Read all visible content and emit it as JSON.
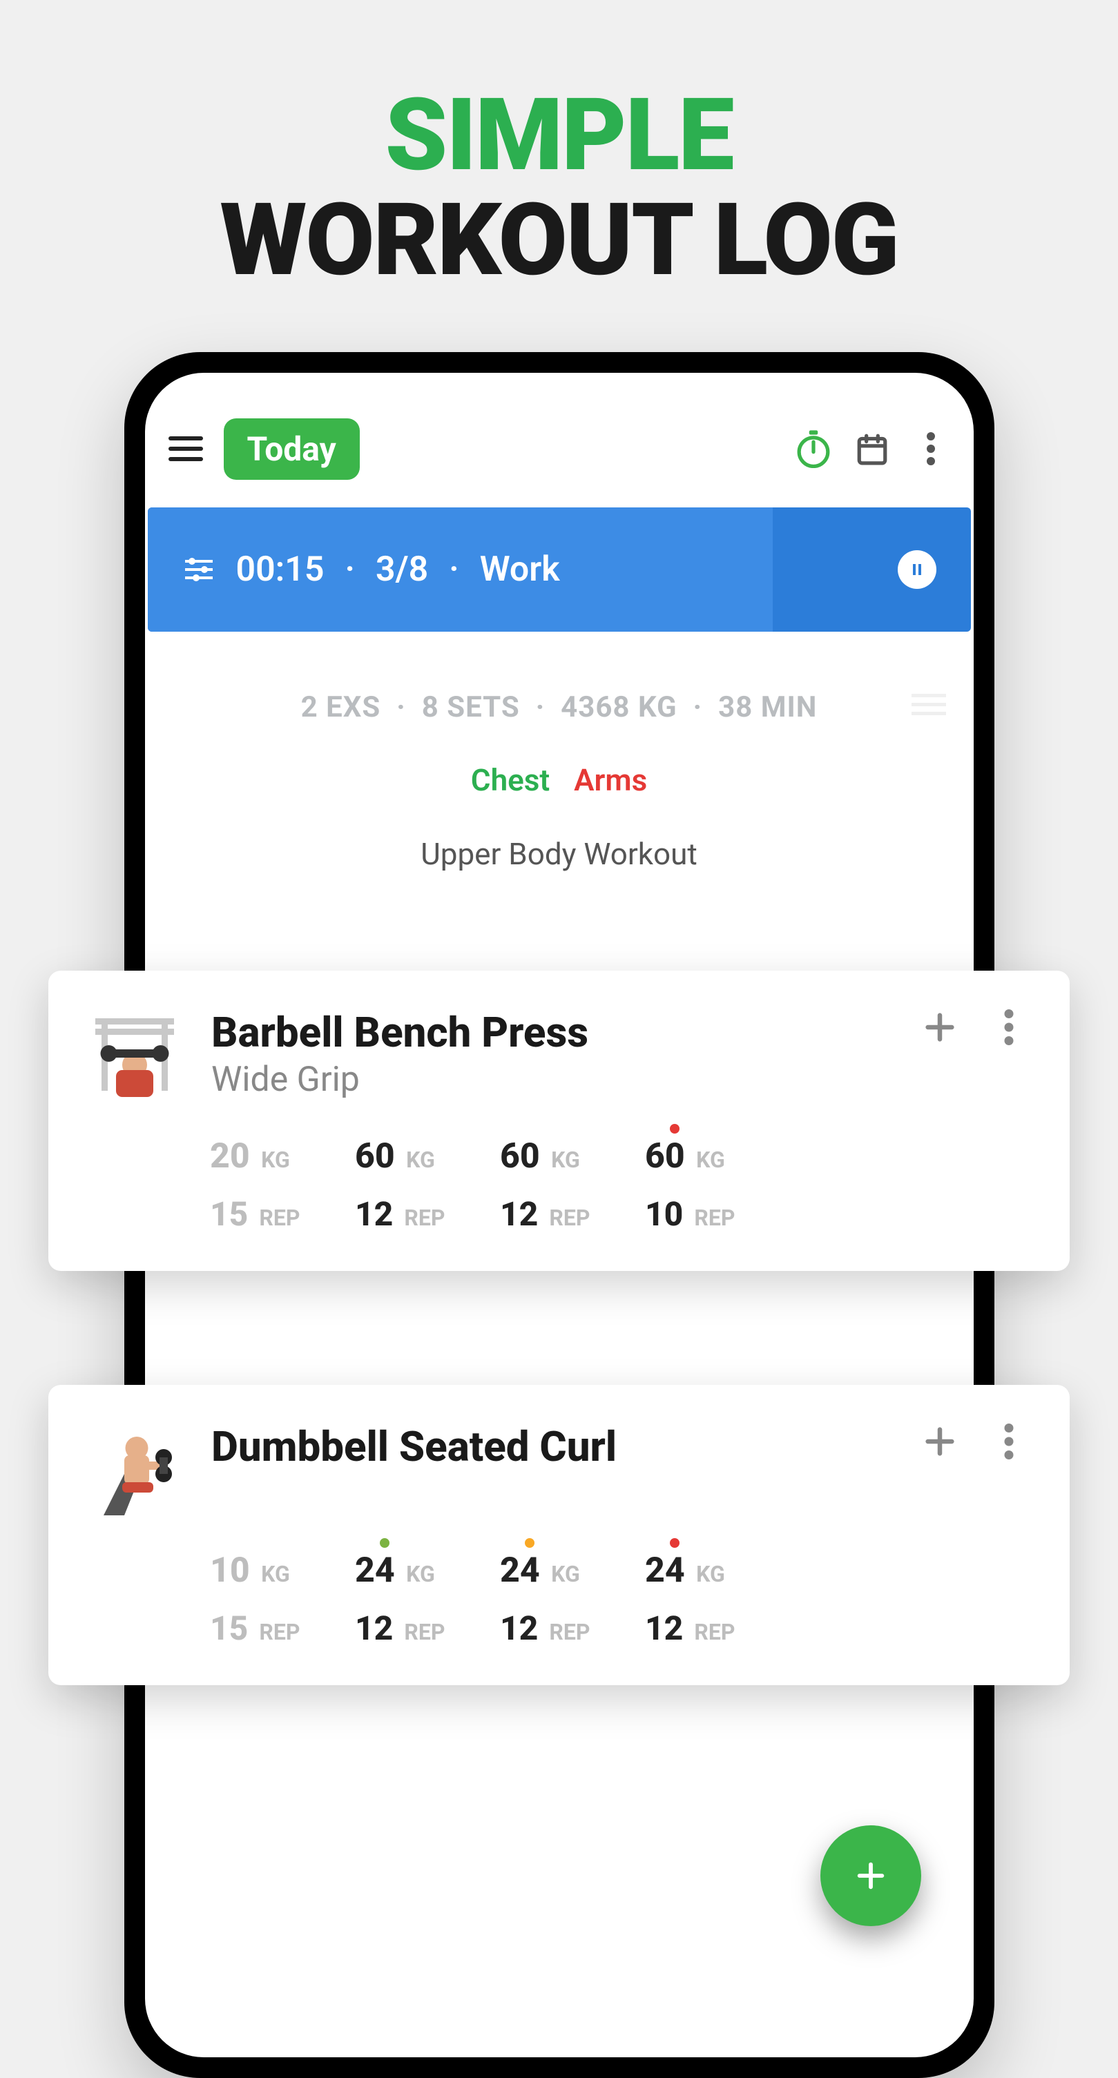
{
  "promo": {
    "line1": "SIMPLE",
    "line2": "WORKOUT LOG"
  },
  "appbar": {
    "today": "Today"
  },
  "timer": {
    "time": "00:15",
    "set": "3/8",
    "phase": "Work"
  },
  "stats": {
    "exs": "2 EXS",
    "sets": "8 SETS",
    "volume": "4368 KG",
    "duration": "38 MIN"
  },
  "tags": {
    "chest": "Chest",
    "arms": "Arms"
  },
  "workout_name": "Upper Body Workout",
  "units": {
    "kg": "KG",
    "rep": "REP"
  },
  "exercises": [
    {
      "name": "Barbell Bench Press",
      "variant": "Wide Grip",
      "sets": [
        {
          "kg": "20",
          "rep": "15",
          "done": true,
          "dot": null
        },
        {
          "kg": "60",
          "rep": "12",
          "done": false,
          "dot": null
        },
        {
          "kg": "60",
          "rep": "12",
          "done": false,
          "dot": null
        },
        {
          "kg": "60",
          "rep": "10",
          "done": false,
          "dot": "#E53935"
        }
      ]
    },
    {
      "name": "Dumbbell Seated Curl",
      "variant": "",
      "sets": [
        {
          "kg": "10",
          "rep": "15",
          "done": true,
          "dot": null
        },
        {
          "kg": "24",
          "rep": "12",
          "done": false,
          "dot": "#7CB342"
        },
        {
          "kg": "24",
          "rep": "12",
          "done": false,
          "dot": "#F9A825"
        },
        {
          "kg": "24",
          "rep": "12",
          "done": false,
          "dot": "#E53935"
        }
      ]
    }
  ]
}
